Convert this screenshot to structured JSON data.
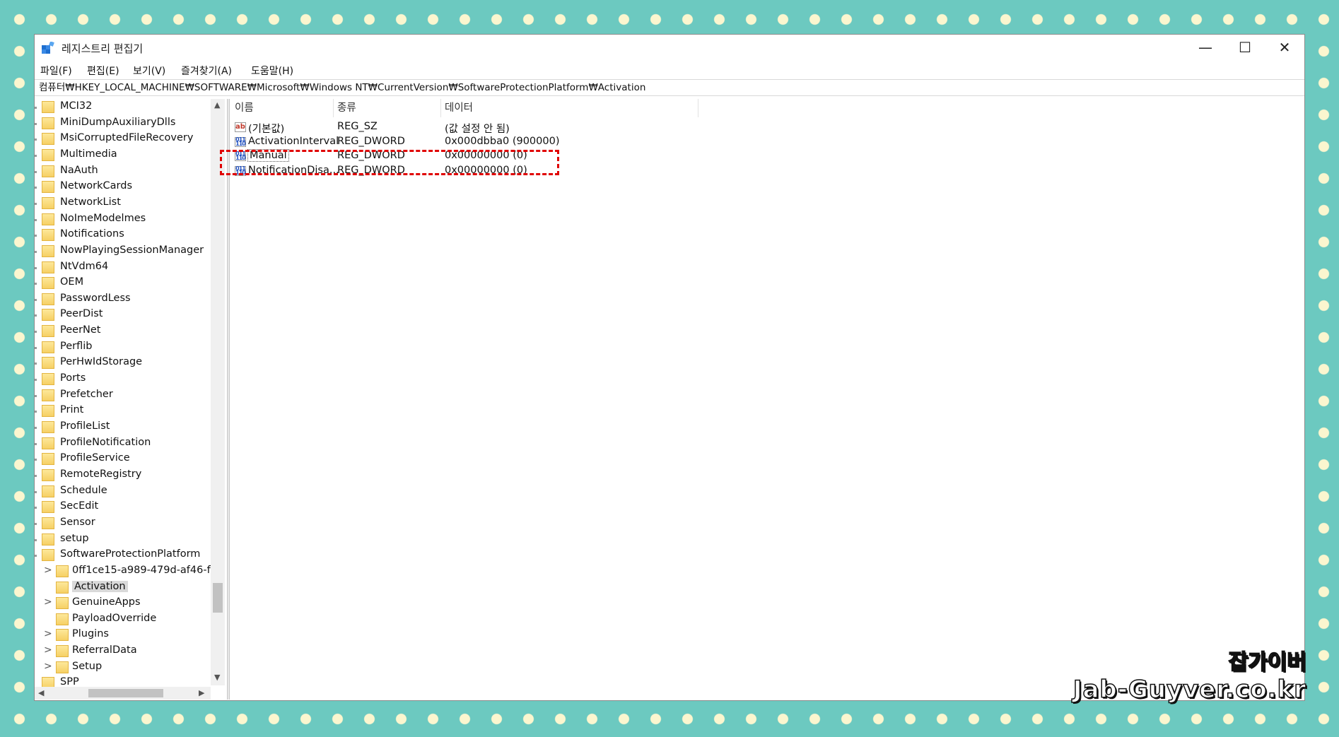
{
  "window": {
    "title": "레지스트리 편집기",
    "controls": {
      "minimize": "—",
      "maximize": "☐",
      "close": "✕"
    }
  },
  "menu": [
    "파일(F)",
    "편집(E)",
    "보기(V)",
    "즐겨찾기(A)",
    "도움말(H)"
  ],
  "address": "컴퓨터₩HKEY_LOCAL_MACHINE₩SOFTWARE₩Microsoft₩Windows NT₩CurrentVersion₩SoftwareProtectionPlatform₩Activation",
  "tree": {
    "items": [
      {
        "label": "MCI32"
      },
      {
        "label": "MiniDumpAuxiliaryDlls"
      },
      {
        "label": "MsiCorruptedFileRecovery"
      },
      {
        "label": "Multimedia"
      },
      {
        "label": "NaAuth"
      },
      {
        "label": "NetworkCards"
      },
      {
        "label": "NetworkList"
      },
      {
        "label": "NoImeModelmes"
      },
      {
        "label": "Notifications"
      },
      {
        "label": "NowPlayingSessionManager"
      },
      {
        "label": "NtVdm64"
      },
      {
        "label": "OEM"
      },
      {
        "label": "PasswordLess"
      },
      {
        "label": "PeerDist"
      },
      {
        "label": "PeerNet"
      },
      {
        "label": "Perflib"
      },
      {
        "label": "PerHwIdStorage"
      },
      {
        "label": "Ports"
      },
      {
        "label": "Prefetcher"
      },
      {
        "label": "Print"
      },
      {
        "label": "ProfileList"
      },
      {
        "label": "ProfileNotification"
      },
      {
        "label": "ProfileService"
      },
      {
        "label": "RemoteRegistry"
      },
      {
        "label": "Schedule"
      },
      {
        "label": "SecEdit"
      },
      {
        "label": "Sensor"
      },
      {
        "label": "setup"
      },
      {
        "label": "SoftwareProtectionPlatform"
      }
    ],
    "children": [
      {
        "label": "0ff1ce15-a989-479d-af46-f",
        "expander": ">"
      },
      {
        "label": "Activation",
        "expander": "",
        "selected": true
      },
      {
        "label": "GenuineApps",
        "expander": ">"
      },
      {
        "label": "PayloadOverride",
        "expander": ""
      },
      {
        "label": "Plugins",
        "expander": ">"
      },
      {
        "label": "ReferralData",
        "expander": ">"
      },
      {
        "label": "Setup",
        "expander": ">"
      }
    ],
    "partial_item": "SPP"
  },
  "list": {
    "columns": [
      "이름",
      "종류",
      "데이터"
    ],
    "rows": [
      {
        "icon": "ab-string-icon",
        "name": "(기본값)",
        "type": "REG_SZ",
        "data": "(값 설정 안 됨)"
      },
      {
        "icon": "binary-value-icon",
        "name": "ActivationInterval",
        "type": "REG_DWORD",
        "data": "0x000dbba0 (900000)"
      },
      {
        "icon": "binary-value-icon",
        "name": "Manual",
        "type": "REG_DWORD",
        "data": "0x00000000 (0)",
        "focused": true
      },
      {
        "icon": "binary-value-icon",
        "name": "NotificationDisa...",
        "type": "REG_DWORD",
        "data": "0x00000000 (0)"
      }
    ]
  },
  "watermark": {
    "line1": "잡가이버",
    "line2": "Jab-Guyver.co.kr"
  },
  "colors": {
    "background": "#6cc9c0",
    "dots": "#fbf6cf",
    "highlight": "#e00000"
  }
}
